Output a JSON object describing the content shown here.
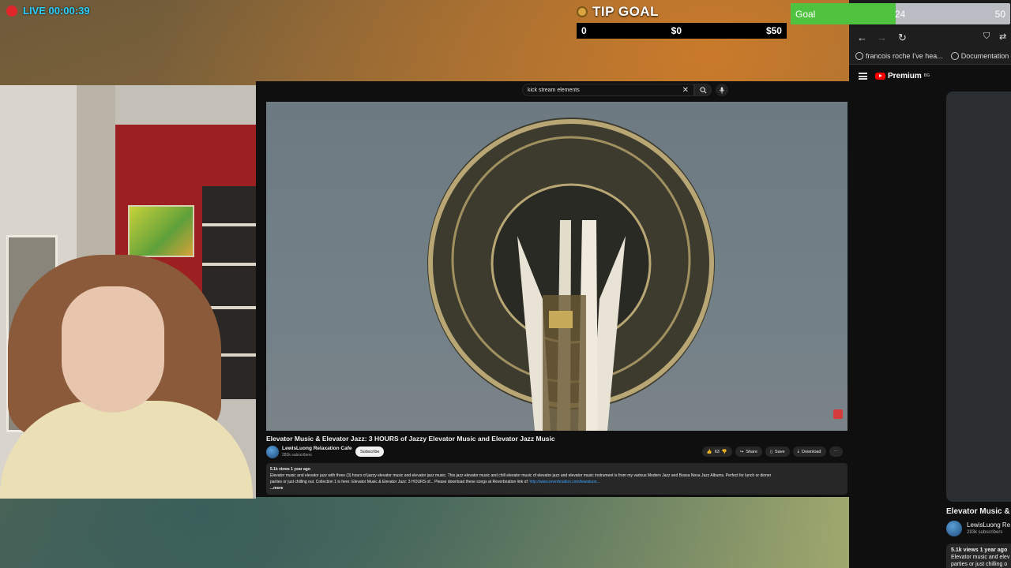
{
  "live": {
    "label": "LIVE 00:00:39"
  },
  "tip_goal": {
    "title": "TIP GOAL",
    "left_value": "0",
    "middle_value": "$0",
    "right_value": "$50"
  },
  "goal_widget": {
    "label": "Goal",
    "current": "24",
    "target": "50",
    "progress_fraction": 0.48
  },
  "youtube": {
    "search_query": "kick stream elements",
    "video_title": "Elevator Music & Elevator Jazz: 3 HOURS of Jazzy Elevator Music and Elevator Jazz Music",
    "channel_name": "LewisLuong Relaxation Cafe",
    "channel_subs": "283k subscribers",
    "subscribe_label": "Subscribe",
    "like_count": "63",
    "share_label": "Share",
    "save_label": "Save",
    "download_label": "Download",
    "meta": "5.1k views  1 year ago",
    "description_line1": "Elevator music and elevator jazz with three (3) hours of jazzy elevator music and elevator jazz music. This jazz elevator music and chill elevator music of elevator jazz and elevator music instrument is from my various Modern Jazz and Bossa Nova Jazz Albums. Perfect for lunch or dinner",
    "description_line2": "parties or just chilling out. Collection 1 is here:",
    "description_link_title": "Elevator Music & Elevator Jazz: 3 HOURS of...",
    "description_download": "Please download these songs at Reverbnation link of:",
    "description_url": "http://www.reverbnation.com/lewisluon...",
    "more_label": "...more"
  },
  "browser": {
    "bookmark1": "francois roche I've hea...",
    "bookmark2": "Documentation —",
    "yt_premium": "Premium",
    "yt_premium_sup": "BG",
    "side_title": "Elevator Music & E",
    "side_channel": "LewisLuong Re",
    "side_subs": "283k subscribers",
    "side_meta": "5.1k views  1 year ago",
    "side_desc1": "Elevator music and elev",
    "side_desc2": "parties or just chilling o"
  },
  "colors": {
    "live_red": "#e0252b",
    "live_text": "#2ad0ff",
    "goal_green": "#4fc33f",
    "youtube_red": "#ff0000"
  }
}
